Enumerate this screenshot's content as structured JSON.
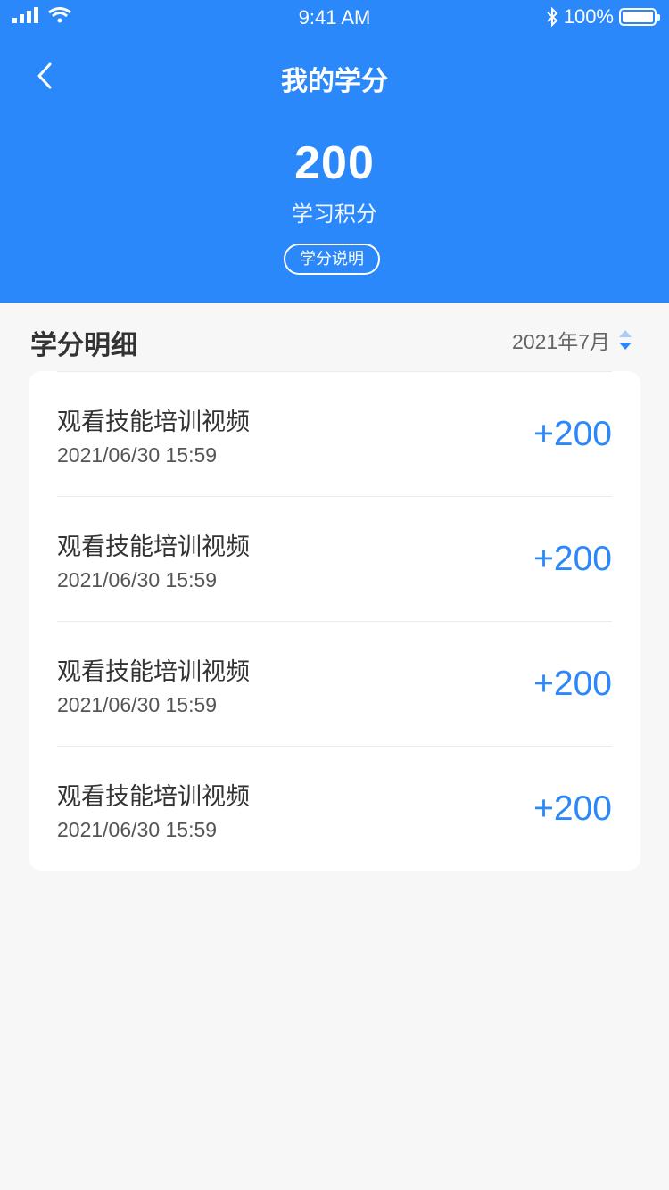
{
  "status": {
    "time": "9:41 AM",
    "battery": "100%"
  },
  "nav": {
    "title": "我的学分"
  },
  "summary": {
    "score": "200",
    "label": "学习积分",
    "explain_button": "学分说明"
  },
  "detail": {
    "title": "学分明细",
    "month": "2021年7月",
    "items": [
      {
        "title": "观看技能培训视频",
        "time": "2021/06/30 15:59",
        "points": "+200"
      },
      {
        "title": "观看技能培训视频",
        "time": "2021/06/30 15:59",
        "points": "+200"
      },
      {
        "title": "观看技能培训视频",
        "time": "2021/06/30 15:59",
        "points": "+200"
      },
      {
        "title": "观看技能培训视频",
        "time": "2021/06/30 15:59",
        "points": "+200"
      }
    ]
  },
  "colors": {
    "primary": "#2b88fa",
    "background": "#f7f7f7"
  }
}
